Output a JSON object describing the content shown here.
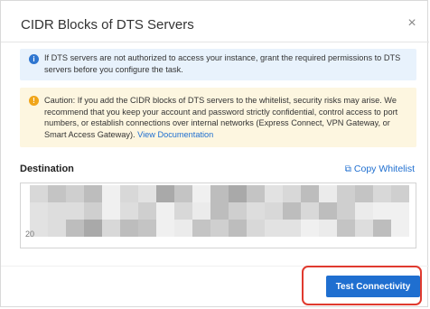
{
  "dialog": {
    "title": "CIDR Blocks of DTS Servers",
    "close_icon": "close-icon"
  },
  "info_notice": {
    "icon": "info-icon",
    "text": "If DTS servers are not authorized to access your instance, grant the required permissions to DTS servers before you configure the task."
  },
  "caution_notice": {
    "icon": "warning-icon",
    "text": "Caution: If you add the CIDR blocks of DTS servers to the whitelist, security risks may arise. We recommend that you keep your account and password strictly confidential, control access to port numbers, or establish connections over internal networks (Express Connect, VPN Gateway, or Smart Access Gateway).",
    "link_text": "View Documentation"
  },
  "destination": {
    "label": "Destination",
    "copy_label": "Copy Whitelist",
    "copy_icon": "copy-icon",
    "visible_tail": "20"
  },
  "footer": {
    "test_button_label": "Test Connectivity"
  },
  "colors": {
    "primary": "#1f6fd0",
    "info_bg": "#e8f2fc",
    "warn_bg": "#fdf6e0",
    "highlight": "#e03a2f"
  }
}
